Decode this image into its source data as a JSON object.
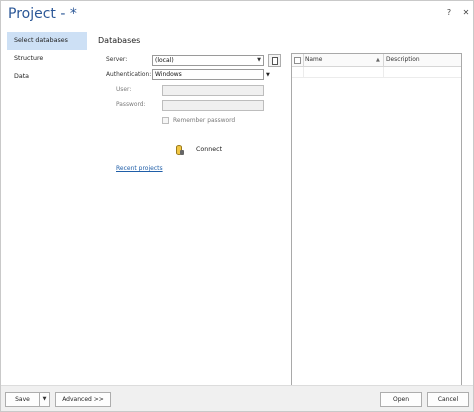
{
  "window": {
    "title": "Project - *",
    "help_label": "?",
    "close_label": "✕"
  },
  "nav": {
    "items": [
      {
        "label": "Select databases",
        "selected": true
      },
      {
        "label": "Structure",
        "selected": false
      },
      {
        "label": "Data",
        "selected": false
      }
    ]
  },
  "databases": {
    "title": "Databases",
    "server_label": "Server:",
    "server_value": "(local)",
    "auth_label": "Authentication:",
    "auth_value": "Windows",
    "user_label": "User:",
    "user_value": "",
    "password_label": "Password:",
    "password_value": "",
    "remember_label": "Remember password",
    "remember_checked": false,
    "connect_label": "Connect",
    "recent_label": "Recent projects"
  },
  "grid": {
    "columns": [
      "Name",
      "Description"
    ],
    "rows": []
  },
  "footer": {
    "save_label": "Save",
    "advanced_label": "Advanced >>",
    "open_label": "Open",
    "cancel_label": "Cancel"
  },
  "icons": {
    "dropdown": "chevron-down-icon",
    "connect": "database-connect-icon",
    "browse": "server-browse-icon",
    "sort": "sort-ascending-icon"
  },
  "colors": {
    "title": "#2b5797",
    "nav_selected": "#cde0f5",
    "link": "#1f5ea8"
  }
}
